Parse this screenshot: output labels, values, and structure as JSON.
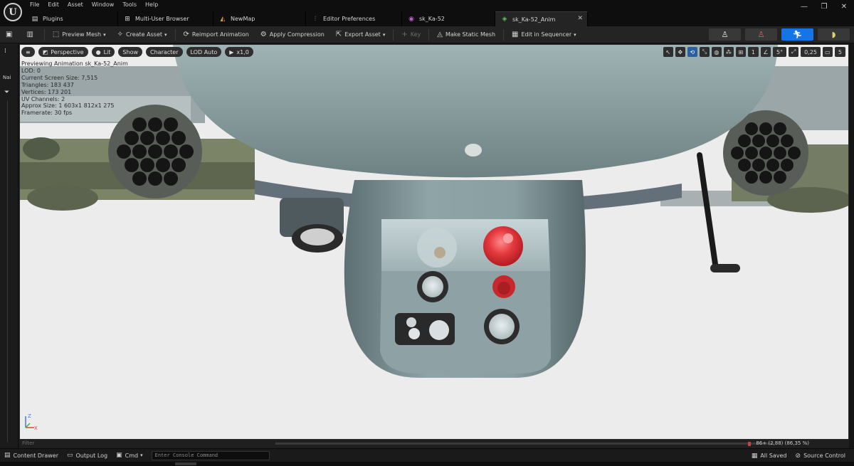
{
  "menu": [
    "File",
    "Edit",
    "Asset",
    "Window",
    "Tools",
    "Help"
  ],
  "tabs": [
    {
      "label": "Plugins",
      "icon": "plug-icon"
    },
    {
      "label": "Multi-User Browser",
      "icon": "multi-user-icon"
    },
    {
      "label": "NewMap",
      "icon": "level-icon"
    },
    {
      "label": "Editor Preferences",
      "icon": "sliders-icon"
    },
    {
      "label": "sk_Ka-52",
      "icon": "skeleton-icon"
    },
    {
      "label": "sk_Ka-52_Anim",
      "icon": "animation-icon",
      "active": true
    }
  ],
  "toolbar": {
    "preview_mesh": "Preview Mesh",
    "create_asset": "Create Asset",
    "reimport_animation": "Reimport Animation",
    "apply_compression": "Apply Compression",
    "export_asset": "Export Asset",
    "key": "Key",
    "make_static_mesh": "Make Static Mesh",
    "edit_in_sequencer": "Edit in Sequencer"
  },
  "left_strip": {
    "label": "Nai"
  },
  "viewport": {
    "view_mode": "Perspective",
    "lighting": "Lit",
    "show": "Show",
    "character": "Character",
    "lod": "LOD Auto",
    "play_rate": "x1,0",
    "grid_size": "1",
    "rotation_snap": "5°",
    "scale_snap": "0,25",
    "camera_speed": "5"
  },
  "stats": [
    "Previewing Animation sk_Ka-52_Anim",
    "LOD: 0",
    "Current Screen Size: 7,515",
    "Triangles: 183 437",
    "Vertices: 173 201",
    "UV Channels: 2",
    "Approx Size: 1 603x1 812x1 275",
    "Framerate: 30 fps"
  ],
  "timeline": {
    "filter_placeholder": "Filter",
    "readout": "86+ (2,88) (86,35 %)"
  },
  "statusbar": {
    "content_drawer": "Content Drawer",
    "output_log": "Output Log",
    "cmd": "Cmd",
    "console_placeholder": "Enter Console Command",
    "all_saved": "All Saved",
    "source_control": "Source Control"
  },
  "colors": {
    "accent_blue": "#1574e6",
    "viewport_bg": "#ececec",
    "sensor_red": "#e0393e"
  }
}
